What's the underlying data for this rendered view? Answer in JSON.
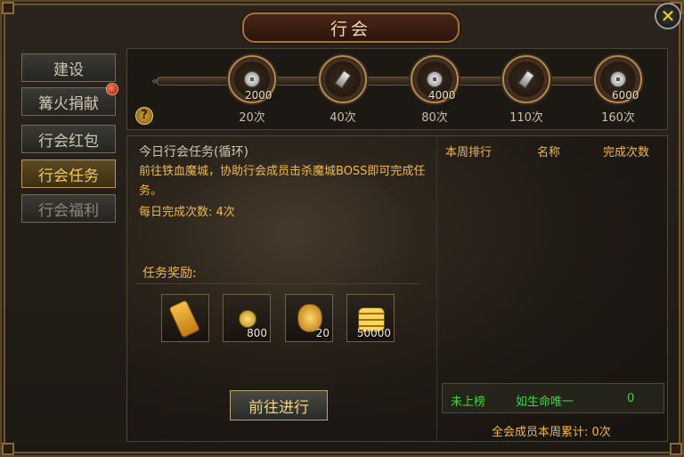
{
  "window": {
    "title": "行会",
    "close_icon": "close-icon"
  },
  "sidebar": {
    "items": [
      {
        "label": "建设",
        "active": false,
        "badge": false
      },
      {
        "label": "篝火捐献",
        "active": false,
        "badge": true
      },
      {
        "label": "行会红包",
        "active": false,
        "badge": false
      },
      {
        "label": "行会任务",
        "active": true,
        "badge": false
      },
      {
        "label": "行会福利",
        "active": false,
        "badge": false
      }
    ]
  },
  "progress": {
    "milestones": [
      {
        "icon": "silver-coin-icon",
        "value": "2000",
        "label": "20次"
      },
      {
        "icon": "silver-ingot-icon",
        "value": "",
        "label": "40次"
      },
      {
        "icon": "silver-coin-icon",
        "value": "4000",
        "label": "80次"
      },
      {
        "icon": "silver-ingot-icon",
        "value": "",
        "label": "110次"
      },
      {
        "icon": "silver-coin-icon",
        "value": "6000",
        "label": "160次"
      }
    ]
  },
  "task": {
    "title": "今日行会任务(循环)",
    "description": "前往铁血魔城，协助行会成员击杀魔城BOSS即可完成任务。",
    "daily_count": "每日完成次数: 4次",
    "reward_label": "任务奖励:",
    "rewards": [
      {
        "icon": "potion-icon",
        "qty": ""
      },
      {
        "icon": "gold-coin-icon",
        "qty": "800"
      },
      {
        "icon": "gold-pot-icon",
        "qty": "20"
      },
      {
        "icon": "gold-stack-icon",
        "qty": "50000"
      }
    ],
    "go_button": "前往进行"
  },
  "ranking": {
    "headers": [
      "本周排行",
      "名称",
      "完成次数"
    ],
    "my_rank": {
      "rank": "未上榜",
      "name": "如生命唯一",
      "count": "0"
    },
    "total": "全会成员本周累计: 0次"
  },
  "colors": {
    "accent": "#f0b84a",
    "active_tab": "#f2c85a",
    "highlight_green": "#3fd53a"
  }
}
